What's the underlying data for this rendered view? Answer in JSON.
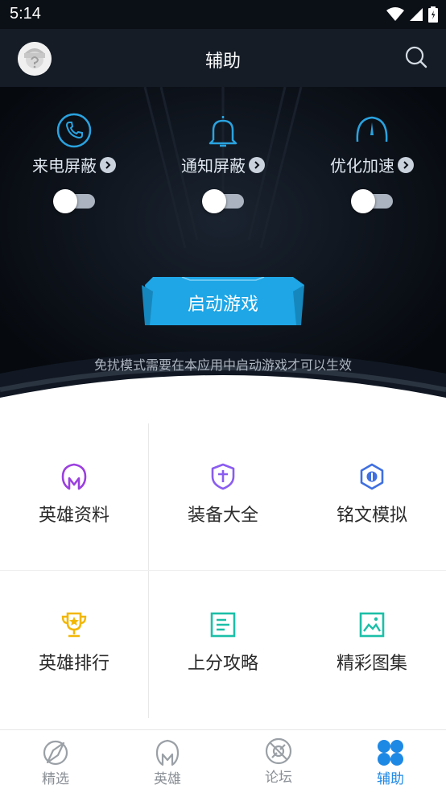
{
  "status_bar": {
    "time": "5:14"
  },
  "app_bar": {
    "title": "辅助"
  },
  "features": [
    {
      "label": "来电屏蔽",
      "icon": "phone-icon",
      "enabled": false
    },
    {
      "label": "通知屏蔽",
      "icon": "bell-icon",
      "enabled": false
    },
    {
      "label": "优化加速",
      "icon": "speedometer-icon",
      "enabled": false
    }
  ],
  "launch": {
    "label": "启动游戏"
  },
  "hint": "免扰模式需要在本应用中启动游戏才可以生效",
  "grid": [
    {
      "label": "英雄资料",
      "icon": "hero-mask-icon",
      "color": "#9b3fe0"
    },
    {
      "label": "装备大全",
      "icon": "shield-icon",
      "color": "#8a5cf0"
    },
    {
      "label": "铭文模拟",
      "icon": "hexagon-icon",
      "color": "#3f6fe0"
    },
    {
      "label": "英雄排行",
      "icon": "trophy-icon",
      "color": "#f2b705"
    },
    {
      "label": "上分攻略",
      "icon": "guide-icon",
      "color": "#1cbfa8"
    },
    {
      "label": "精彩图集",
      "icon": "gallery-icon",
      "color": "#1cbfa8"
    }
  ],
  "bottom_nav": [
    {
      "label": "精选",
      "icon": "compass-icon",
      "active": false
    },
    {
      "label": "英雄",
      "icon": "helmet-icon",
      "active": false
    },
    {
      "label": "论坛",
      "icon": "forum-icon",
      "active": false
    },
    {
      "label": "辅助",
      "icon": "clover-icon",
      "active": true
    }
  ],
  "colors": {
    "accent": "#1e88e5",
    "launch_button": "#1ea6e6",
    "feature_icon": "#2aa3e0"
  }
}
